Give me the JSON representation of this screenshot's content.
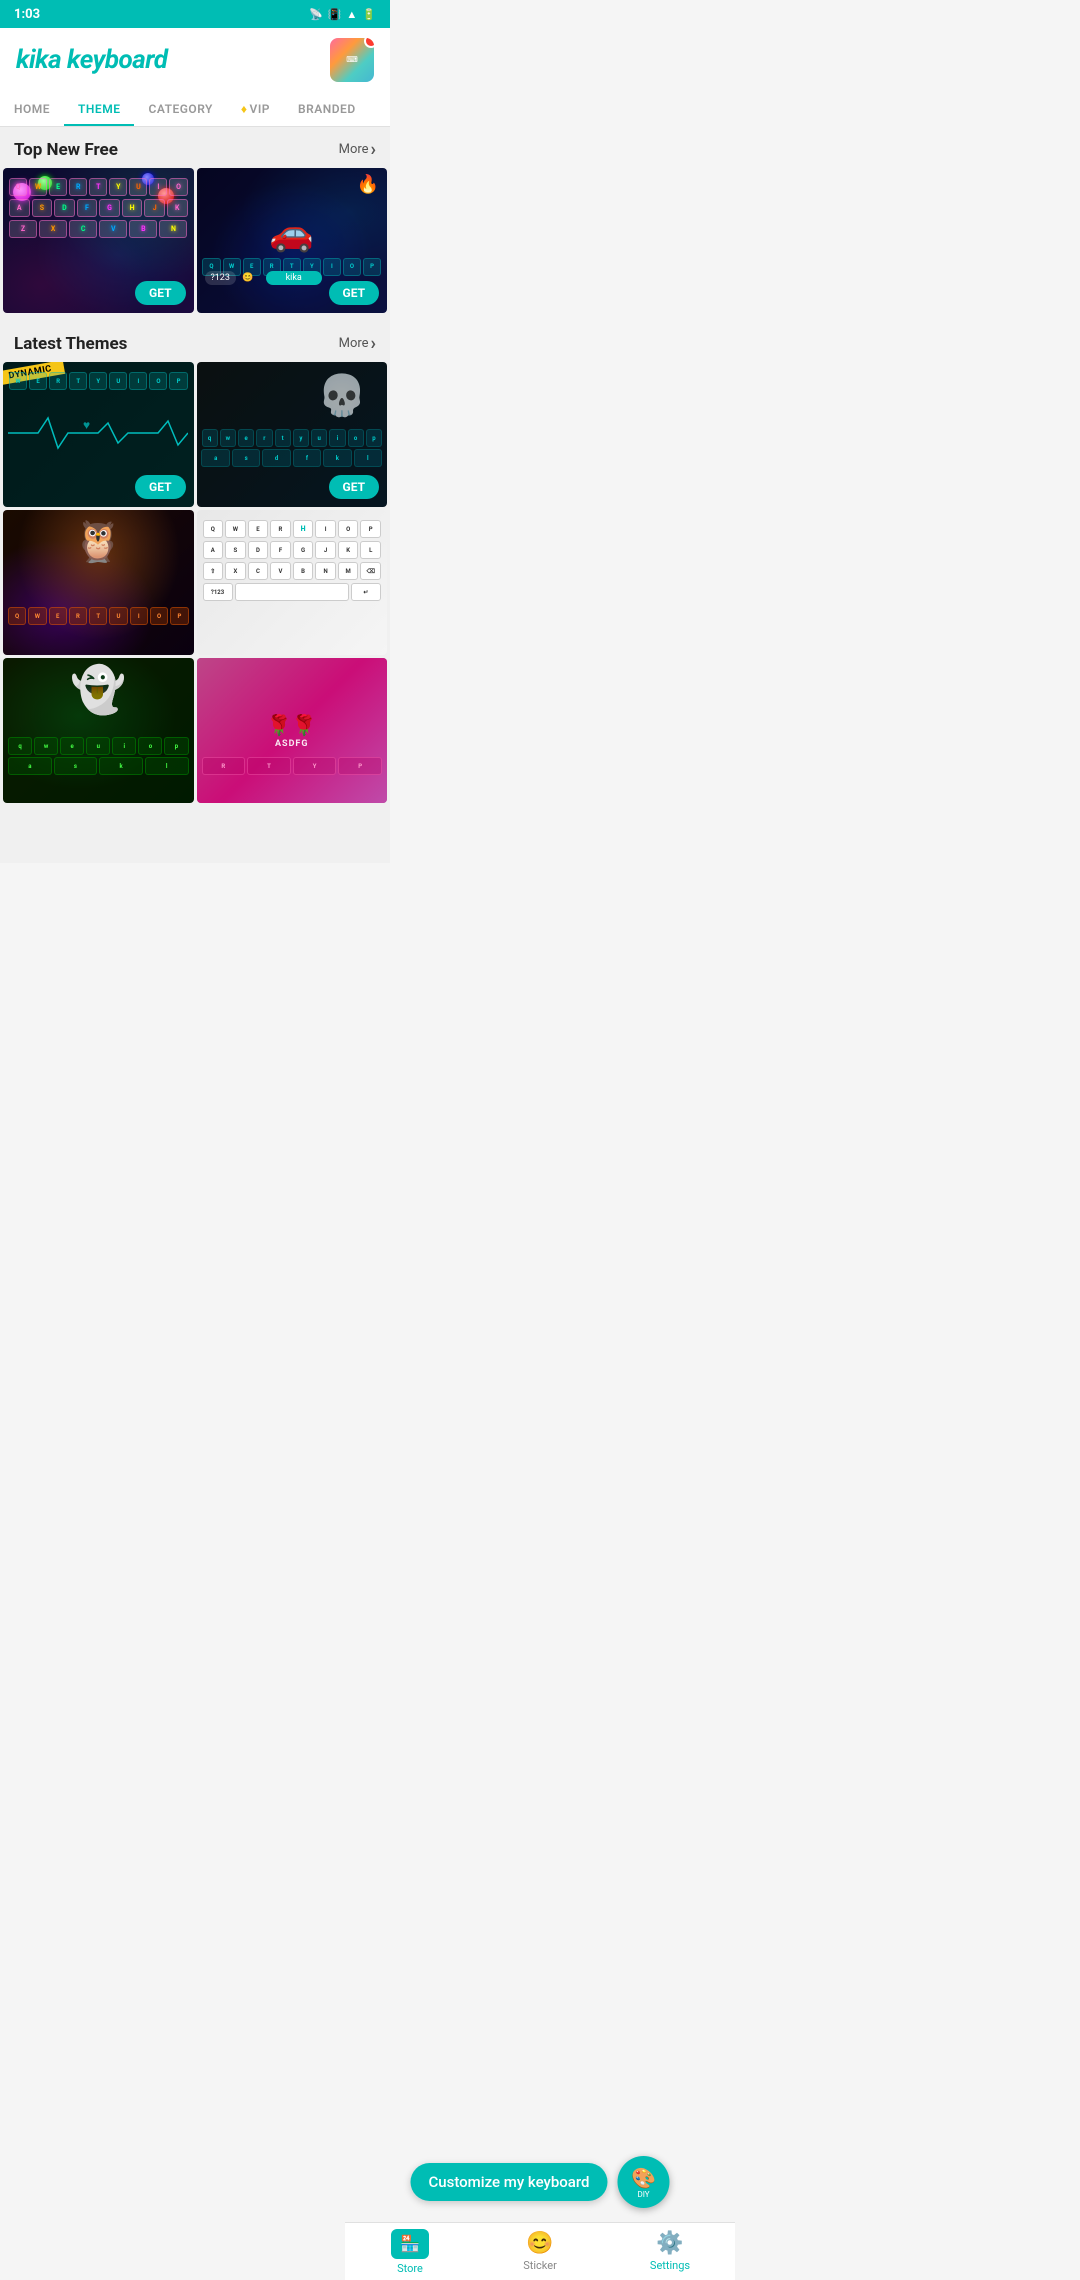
{
  "status": {
    "time": "1:03",
    "icons": [
      "▣",
      "•"
    ]
  },
  "header": {
    "app_title": "kika keyboard",
    "avatar_notification": true
  },
  "nav": {
    "tabs": [
      {
        "id": "home",
        "label": "HOME",
        "active": false
      },
      {
        "id": "theme",
        "label": "THEME",
        "active": true
      },
      {
        "id": "category",
        "label": "CATEGORY",
        "active": false
      },
      {
        "id": "vip",
        "label": "VIP",
        "active": false,
        "has_diamond": true
      },
      {
        "id": "branded",
        "label": "BRANDED",
        "active": false
      }
    ]
  },
  "sections": {
    "top_new_free": {
      "title": "Top New Free",
      "more_label": "More"
    },
    "latest_themes": {
      "title": "Latest Themes",
      "more_label": "More"
    }
  },
  "themes": {
    "top": [
      {
        "id": "neon",
        "style": "neon"
      },
      {
        "id": "car",
        "style": "car"
      }
    ],
    "latest": [
      {
        "id": "heartbeat",
        "style": "heartbeat",
        "dynamic": true
      },
      {
        "id": "skull",
        "style": "skull"
      },
      {
        "id": "owl",
        "style": "owl"
      },
      {
        "id": "white",
        "style": "white"
      },
      {
        "id": "ghost",
        "style": "ghost"
      },
      {
        "id": "flower",
        "style": "flower"
      }
    ]
  },
  "get_button": "GET",
  "customize": {
    "label": "Customize my keyboard",
    "diy": "DIY"
  },
  "bottom_nav": {
    "items": [
      {
        "id": "store",
        "label": "Store",
        "active": true,
        "icon": "🏪"
      },
      {
        "id": "sticker",
        "label": "Sticker",
        "active": false,
        "icon": "😊"
      },
      {
        "id": "settings",
        "label": "Settings",
        "active": false,
        "icon": "⚙️"
      }
    ]
  },
  "keys": {
    "row1": [
      "Q",
      "W",
      "E",
      "R",
      "T",
      "Y",
      "U",
      "I",
      "O",
      "P"
    ],
    "row2": [
      "A",
      "S",
      "D",
      "F",
      "G",
      "H",
      "J",
      "K",
      "L"
    ],
    "row3": [
      "Z",
      "X",
      "C",
      "V",
      "B",
      "N",
      "M"
    ]
  }
}
